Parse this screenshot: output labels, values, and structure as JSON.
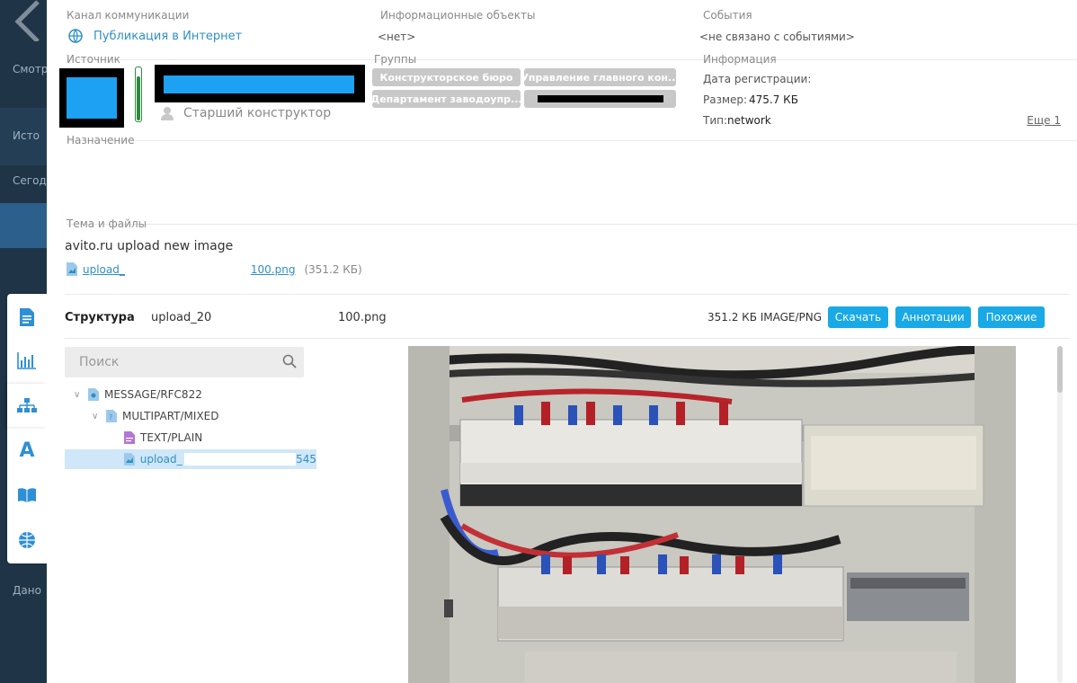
{
  "sidebar": {
    "items": [
      "Смотр",
      "Исто",
      "Сегод",
      "Дано"
    ]
  },
  "header": {
    "channel_label": "Канал коммуникации",
    "channel_value": "Публикация в Интернет",
    "info_objects_label": "Информационные объекты",
    "info_objects_value": "<нет>",
    "events_label": "События",
    "events_value": "<не связано с событиями>"
  },
  "source": {
    "label": "Источник",
    "role": "Старший конструктор",
    "status_level_percent": 85
  },
  "groups": {
    "label": "Группы",
    "chips": [
      "Конструкторское бюро",
      "Управление главного кон...",
      "Департамент заводоупр..."
    ]
  },
  "information": {
    "label": "Информация",
    "reg_date_label": "Дата регистрации:",
    "size_label": "Размер:",
    "size_value": "475.7 КБ",
    "type_label": "Тип:",
    "type_value": "network",
    "more_link": "Еще 1"
  },
  "purpose": {
    "label": "Назначение"
  },
  "topic": {
    "label": "Тема и файлы",
    "subject": "avito.ru upload new image",
    "file_name_start": "upload_",
    "file_name_end": "100.png",
    "file_size": "(351.2 КБ)"
  },
  "structure": {
    "title": "Структура",
    "file_name_start": "upload_20",
    "file_name_end": "100.png",
    "size_type": "351.2 КБ  IMAGE/PNG",
    "download_button": "Скачать",
    "annotations_button": "Аннотации",
    "similar_button": "Похожие",
    "search_placeholder": "Поиск",
    "tree": [
      {
        "label": "MESSAGE/RFC822"
      },
      {
        "label": "MULTIPART/MIXED"
      },
      {
        "label": "TEXT/PLAIN"
      },
      {
        "label": "upload_",
        "suffix": "545"
      }
    ]
  },
  "colors": {
    "accent": "#19a9e6",
    "link": "#2f8fc4",
    "sidebar_bg": "#1f3446",
    "selected_row": "#cfe7f8"
  }
}
